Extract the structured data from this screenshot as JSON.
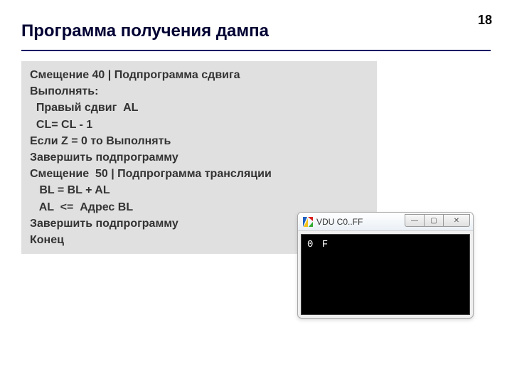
{
  "page_number": "18",
  "title": "Программа получения дампа",
  "code": {
    "l1": "Смещение 40 | Подпрограмма сдвига",
    "l2": "Выполнять:",
    "l3": "  Правый сдвиг  AL",
    "l4": "  CL= CL - 1",
    "l5": "Если Z = 0 то Выполнять",
    "l6": "Завершить подпрограмму",
    "l7": "Смещение  50 | Подпрограмма трансляции",
    "l8": "   BL = BL + AL",
    "l9": "   AL  <=  Адрес BL",
    "l10": "Завершить подпрограмму",
    "l11": "Конец"
  },
  "vdu": {
    "title": "VDU C0..FF",
    "output": "0 F",
    "buttons": {
      "min": "—",
      "max": "▢",
      "close": "✕"
    }
  }
}
